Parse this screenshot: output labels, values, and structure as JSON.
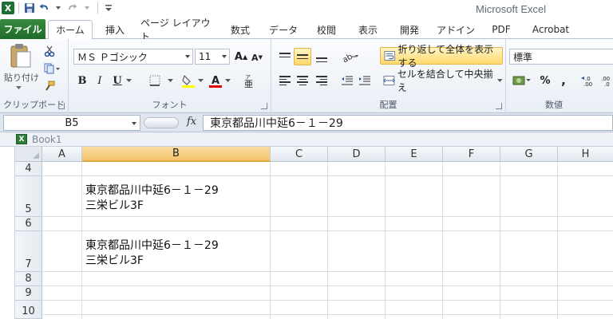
{
  "app_title": "Microsoft Excel",
  "tabs": [
    {
      "label": "ファイル",
      "name": "tab-file"
    },
    {
      "label": "ホーム",
      "name": "tab-home"
    },
    {
      "label": "挿入",
      "name": "tab-insert"
    },
    {
      "label": "ページ レイアウト",
      "name": "tab-page-layout"
    },
    {
      "label": "数式",
      "name": "tab-formulas"
    },
    {
      "label": "データ",
      "name": "tab-data"
    },
    {
      "label": "校閲",
      "name": "tab-review"
    },
    {
      "label": "表示",
      "name": "tab-view"
    },
    {
      "label": "開発",
      "name": "tab-developer"
    },
    {
      "label": "アドイン",
      "name": "tab-addins"
    },
    {
      "label": "PDF",
      "name": "tab-pdf"
    },
    {
      "label": "Acrobat",
      "name": "tab-acrobat"
    }
  ],
  "ribbon": {
    "clipboard": {
      "label": "クリップボード",
      "paste_label": "貼り付け"
    },
    "font": {
      "label": "フォント",
      "font_name": "ＭＳ Ｐゴシック",
      "font_size": "11"
    },
    "alignment": {
      "label": "配置",
      "wrap_text": "折り返して全体を表示する",
      "merge_center": "セルを結合して中央揃え"
    },
    "number": {
      "label": "数値",
      "format": "標準",
      "percent": "%",
      "comma": ","
    }
  },
  "formula_bar": {
    "name_box": "B5",
    "fx": "fx",
    "formula": "東京都品川中延6－１－29"
  },
  "workbook": {
    "name": "Book1"
  },
  "columns": [
    "A",
    "B",
    "C",
    "D",
    "E",
    "F",
    "G",
    "H"
  ],
  "rows": [
    "4",
    "5",
    "6",
    "7",
    "8",
    "9",
    "10"
  ],
  "cells": {
    "B5": {
      "line1": "東京都品川中延6－１－29",
      "line2": "三栄ビル3F"
    },
    "B7": {
      "line1": "東京都品川中延6－１－29",
      "line2": "三栄ビル3F"
    }
  },
  "selected_cell": "B5",
  "colors": {
    "file_tab": "#2b7b34",
    "selection": "#f5c56d",
    "highlight": "#ffd86b"
  }
}
